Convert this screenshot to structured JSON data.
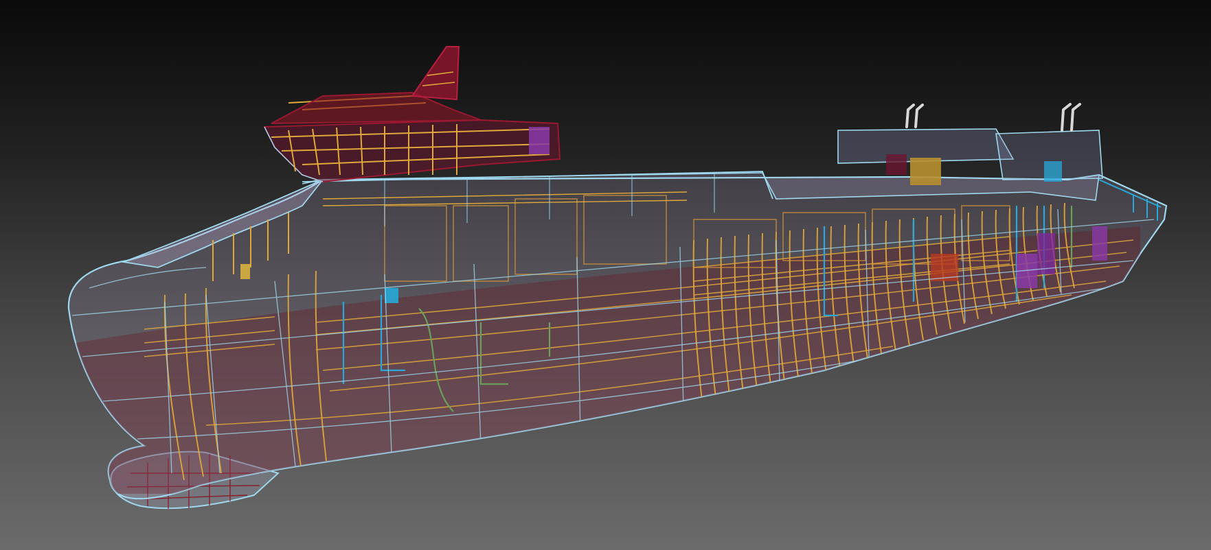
{
  "scene": {
    "subject": "ship-hull-3d-model",
    "render_mode": "transparent-wireframe",
    "colors": {
      "background_top": "#0a0a0a",
      "background_bottom": "#6b6b6b",
      "hull_outline": "#9fd8ee",
      "hull_fill": "#b8c6e0",
      "frame_structure": "#e0a83a",
      "plating": "#8a1020",
      "piping_cyan": "#28a8d8",
      "piping_green": "#6aa05a",
      "equipment_purple": "#8a3aa8",
      "exhaust_pipes": "#d8d8d8"
    }
  }
}
